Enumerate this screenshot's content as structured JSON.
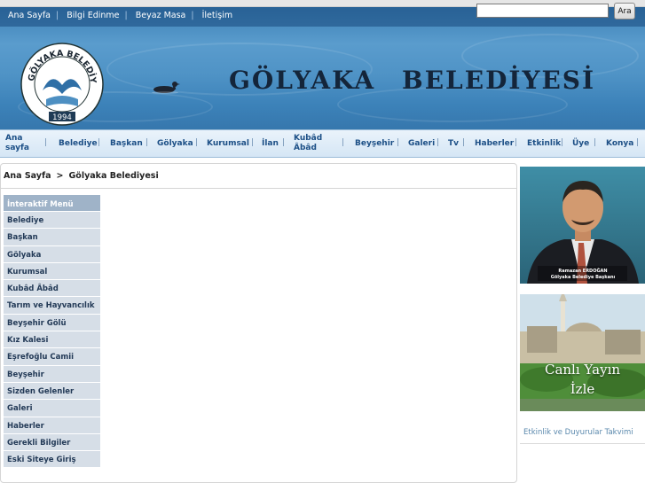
{
  "top_links": [
    "Ana Sayfa",
    "Bilgi Edinme",
    "Beyaz Masa",
    "İletişim"
  ],
  "search": {
    "placeholder": "",
    "value": "",
    "button_label": "Ara"
  },
  "logo": {
    "text": "GÖLYAKA BELEDİYESİ",
    "year": "1994"
  },
  "site_title": {
    "word1": "GÖLYAKA",
    "word2": "BELEDİYESİ"
  },
  "main_nav": {
    "items": [
      "Ana sayfa",
      "Belediye",
      "Başkan",
      "Gölyaka",
      "Kurumsal",
      "İlan",
      "Kubâd Âbâd",
      "Beyşehir",
      "Galeri",
      "Tv",
      "Haberler",
      "Etkinlik",
      "Üye",
      "Konya"
    ]
  },
  "breadcrumb": {
    "home": "Ana Sayfa",
    "separator": ">",
    "current": "Gölyaka Belediyesi"
  },
  "side_menu": {
    "heading": "İnteraktif Menü",
    "items": [
      "Belediye",
      "Başkan",
      "Gölyaka",
      "Kurumsal",
      "Kubâd Âbâd",
      "Tarım ve Hayvancılık",
      "Beyşehir Gölü",
      "Kız Kalesi",
      "Eşrefoğlu Camii",
      "Beyşehir",
      "Sizden Gelenler",
      "Galeri",
      "Haberler",
      "Gerekli Bilgiler",
      "Eski Siteye Giriş"
    ]
  },
  "mayor_photo": {
    "caption_name": "Ramazan ERDOĞAN",
    "caption_title": "Gölyaka Belediye Başkanı"
  },
  "live_stream": {
    "line1": "Canlı Yayın",
    "line2": "İzle"
  },
  "events": {
    "label": "Etkinlik ve Duyurular Takvimi"
  },
  "colors": {
    "header_blue": "#4f93c6",
    "nav_text": "#1c4f86",
    "menu_bg": "#d6dee7",
    "menu_head": "#9fb3c8"
  }
}
